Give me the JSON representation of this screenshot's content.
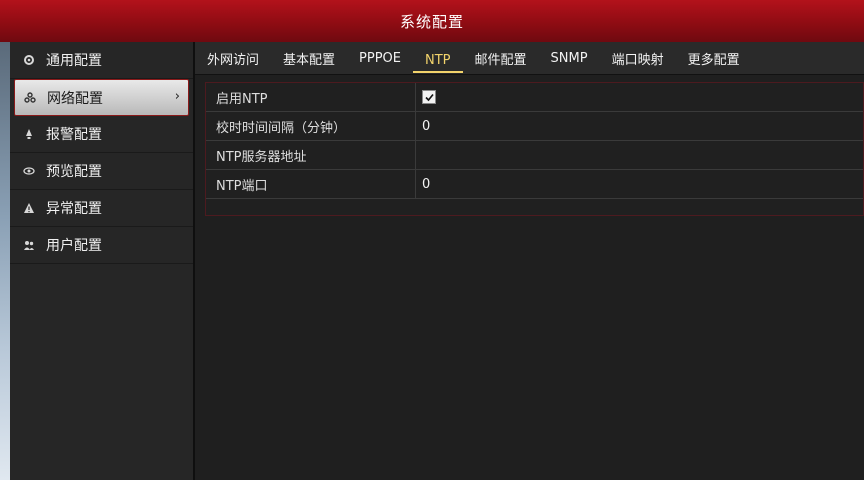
{
  "window": {
    "title": "系统配置"
  },
  "sidebar": {
    "items": [
      {
        "label": "通用配置",
        "icon": "gear-icon"
      },
      {
        "label": "网络配置",
        "icon": "network-icon",
        "arrow": "›"
      },
      {
        "label": "报警配置",
        "icon": "bell-icon"
      },
      {
        "label": "预览配置",
        "icon": "eye-icon"
      },
      {
        "label": "异常配置",
        "icon": "warning-icon"
      },
      {
        "label": "用户配置",
        "icon": "users-icon"
      }
    ]
  },
  "tabs": [
    {
      "label": "外网访问"
    },
    {
      "label": "基本配置"
    },
    {
      "label": "PPPOE"
    },
    {
      "label": "NTP"
    },
    {
      "label": "邮件配置"
    },
    {
      "label": "SNMP"
    },
    {
      "label": "端口映射"
    },
    {
      "label": "更多配置"
    }
  ],
  "form": {
    "rows": [
      {
        "label": "启用NTP",
        "checked": true
      },
      {
        "label": "校时时间间隔（分钟）",
        "value": "0"
      },
      {
        "label": "NTP服务器地址",
        "value": ""
      },
      {
        "label": "NTP端口",
        "value": "0"
      }
    ]
  },
  "colors": {
    "accent": "#b3121b",
    "active_tab": "#f2d36b"
  }
}
